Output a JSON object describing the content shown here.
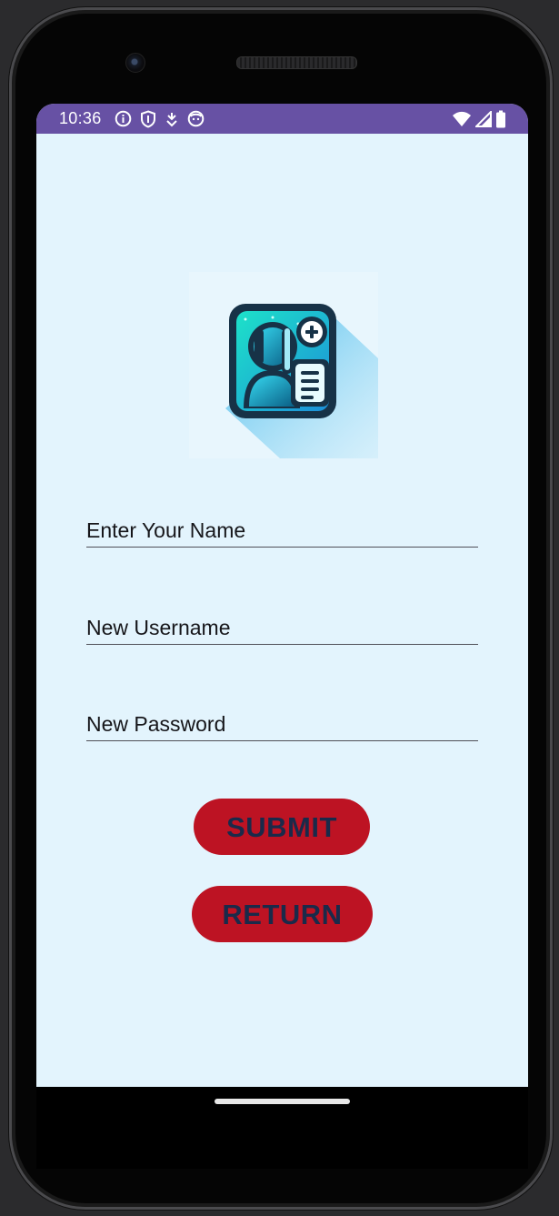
{
  "status_bar": {
    "time": "10:36",
    "left_icons": [
      "info-icon",
      "shield-icon",
      "download-arrow-icon",
      "face-icon"
    ],
    "right_icons": [
      "wifi-icon",
      "cell-signal-icon",
      "battery-icon"
    ],
    "color": "#6751a4"
  },
  "form": {
    "name_placeholder": "Enter Your Name",
    "username_placeholder": "New Username",
    "password_placeholder": "New Password"
  },
  "buttons": {
    "submit_label": "SUBMIT",
    "return_label": "RETURN"
  },
  "theme": {
    "background": "#e3f4fd",
    "button_color": "#bd1323",
    "button_text_color": "#1a2a4a"
  },
  "logo": {
    "icon": "user-register-icon"
  }
}
